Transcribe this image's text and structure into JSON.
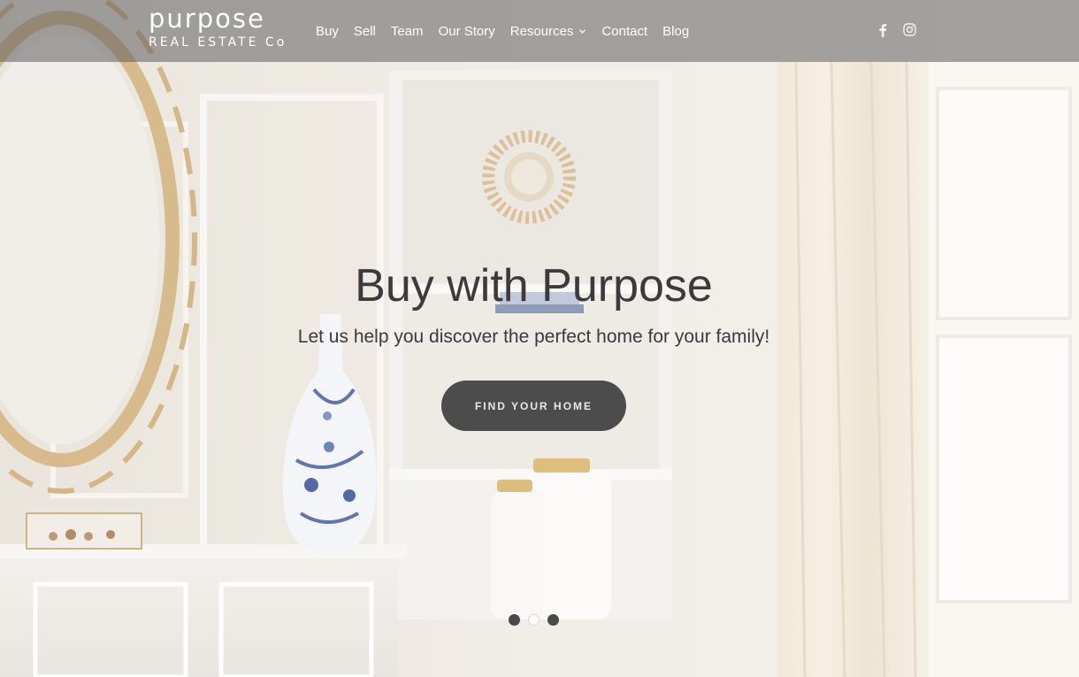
{
  "brand": {
    "name": "purpose",
    "tagline": "REAL ESTATE Co"
  },
  "nav": {
    "items": [
      {
        "label": "Buy"
      },
      {
        "label": "Sell"
      },
      {
        "label": "Team"
      },
      {
        "label": "Our Story"
      },
      {
        "label": "Resources",
        "icon": "chevron-down-icon"
      },
      {
        "label": "Contact"
      },
      {
        "label": "Blog"
      }
    ]
  },
  "social": {
    "icons": [
      "facebook-icon",
      "instagram-icon"
    ]
  },
  "hero": {
    "title": "Buy with Purpose",
    "subtitle": "Let us help you discover the perfect home for your family!",
    "cta_label": "FIND YOUR HOME",
    "slide_count": 3,
    "active_slide": 2
  },
  "colors": {
    "header_overlay": "#5f5f5f",
    "title_text": "#3b3b3b",
    "cta_background": "#4c4c4c",
    "cta_text": "#e9e9e9",
    "dot_inactive": "#4a4a4a",
    "dot_active": "#ffffff"
  }
}
